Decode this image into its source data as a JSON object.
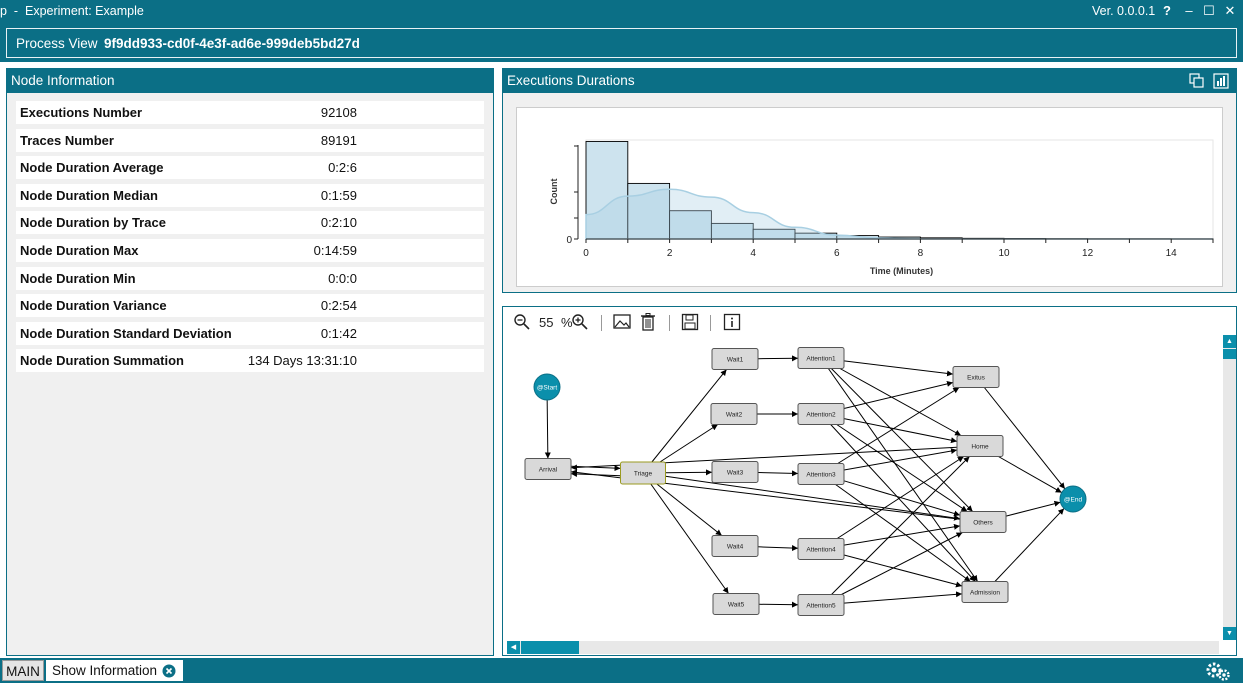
{
  "titlebar": {
    "title": "p  -  Experiment: Example",
    "version": "Ver. 0.0.0.1",
    "help_icon": "?",
    "minimize_icon": "–",
    "maximize_icon": "☐",
    "close_icon": "✕"
  },
  "process_view": {
    "label": "Process View",
    "id": "9f9dd933-cd0f-4e3f-ad6e-999deb5bd27d"
  },
  "node_info": {
    "title": "Node Information",
    "rows": [
      {
        "key": "Executions Number",
        "value": "92108"
      },
      {
        "key": "Traces Number",
        "value": "89191"
      },
      {
        "key": "Node Duration Average",
        "value": "0:2:6"
      },
      {
        "key": "Node Duration Median",
        "value": "0:1:59"
      },
      {
        "key": "Node Duration by Trace",
        "value": "0:2:10"
      },
      {
        "key": "Node Duration Max",
        "value": "0:14:59"
      },
      {
        "key": "Node Duration Min",
        "value": "0:0:0"
      },
      {
        "key": "Node Duration Variance",
        "value": "0:2:54"
      },
      {
        "key": "Node Duration Standard Deviation",
        "value": "0:1:42"
      },
      {
        "key": "Node Duration Summation",
        "value": "134 Days 13:31:10"
      }
    ]
  },
  "exec_panel": {
    "title": "Executions Durations"
  },
  "chart_data": {
    "type": "bar",
    "xlabel": "Time (Minutes)",
    "ylabel": "Count",
    "xlim": [
      0,
      15
    ],
    "x_ticks": [
      0,
      2,
      4,
      6,
      8,
      10,
      12,
      14
    ],
    "y_ticks": [
      0
    ],
    "bins": [
      0,
      1,
      2,
      3,
      4,
      5,
      6,
      7,
      8,
      9,
      10,
      11,
      12,
      13,
      14,
      15
    ],
    "values": [
      1.0,
      0.57,
      0.29,
      0.16,
      0.1,
      0.06,
      0.035,
      0.02,
      0.012,
      0.007,
      0.005,
      0.003,
      0.002,
      0.002,
      0.001
    ],
    "kde": [
      [
        0,
        0.25
      ],
      [
        1,
        0.44
      ],
      [
        2,
        0.51
      ],
      [
        3,
        0.43
      ],
      [
        4,
        0.27
      ],
      [
        5,
        0.12
      ],
      [
        6,
        0.04
      ],
      [
        7,
        0.01
      ],
      [
        8,
        0.0
      ],
      [
        15,
        0.0
      ]
    ],
    "colors": {
      "bar": "#cde3ee",
      "bar_edge": "#000000",
      "kde": "#a8cfe2"
    }
  },
  "graph_panel": {
    "zoom": "55",
    "zoom_unit": "%"
  },
  "graph": {
    "nodes": [
      {
        "id": "start",
        "label": "@Start",
        "kind": "circle"
      },
      {
        "id": "end",
        "label": "@End",
        "kind": "circle"
      },
      {
        "id": "arrival",
        "label": "Arrival"
      },
      {
        "id": "triage",
        "label": "Triage",
        "highlight": true
      },
      {
        "id": "wait1",
        "label": "Wait1"
      },
      {
        "id": "wait2",
        "label": "Wait2"
      },
      {
        "id": "wait3",
        "label": "Wait3"
      },
      {
        "id": "wait4",
        "label": "Wait4"
      },
      {
        "id": "wait5",
        "label": "Wait5"
      },
      {
        "id": "att1",
        "label": "Attention1"
      },
      {
        "id": "att2",
        "label": "Attention2"
      },
      {
        "id": "att3",
        "label": "Attention3"
      },
      {
        "id": "att4",
        "label": "Attention4"
      },
      {
        "id": "att5",
        "label": "Attention5"
      },
      {
        "id": "exitus",
        "label": "Exitus"
      },
      {
        "id": "home",
        "label": "Home"
      },
      {
        "id": "others",
        "label": "Others"
      },
      {
        "id": "admission",
        "label": "Admission"
      }
    ],
    "edges": [
      [
        "start",
        "arrival"
      ],
      [
        "arrival",
        "triage"
      ],
      [
        "triage",
        "arrival"
      ],
      [
        "triage",
        "wait1"
      ],
      [
        "triage",
        "wait2"
      ],
      [
        "triage",
        "wait3"
      ],
      [
        "triage",
        "wait4"
      ],
      [
        "triage",
        "wait5"
      ],
      [
        "wait1",
        "att1"
      ],
      [
        "wait2",
        "att2"
      ],
      [
        "wait3",
        "att3"
      ],
      [
        "wait4",
        "att4"
      ],
      [
        "wait5",
        "att5"
      ],
      [
        "att1",
        "exitus"
      ],
      [
        "att1",
        "home"
      ],
      [
        "att1",
        "others"
      ],
      [
        "att1",
        "admission"
      ],
      [
        "att2",
        "exitus"
      ],
      [
        "att2",
        "home"
      ],
      [
        "att2",
        "others"
      ],
      [
        "att2",
        "admission"
      ],
      [
        "att3",
        "exitus"
      ],
      [
        "att3",
        "home"
      ],
      [
        "att3",
        "others"
      ],
      [
        "att3",
        "admission"
      ],
      [
        "att4",
        "home"
      ],
      [
        "att4",
        "others"
      ],
      [
        "att4",
        "admission"
      ],
      [
        "att5",
        "home"
      ],
      [
        "att5",
        "others"
      ],
      [
        "att5",
        "admission"
      ],
      [
        "triage",
        "others"
      ],
      [
        "home",
        "arrival"
      ],
      [
        "others",
        "arrival"
      ],
      [
        "exitus",
        "end"
      ],
      [
        "home",
        "end"
      ],
      [
        "others",
        "end"
      ],
      [
        "admission",
        "end"
      ]
    ]
  },
  "bottom": {
    "main_tab": "MAIN",
    "info_tab": "Show Information",
    "settings_icon": "gears"
  }
}
